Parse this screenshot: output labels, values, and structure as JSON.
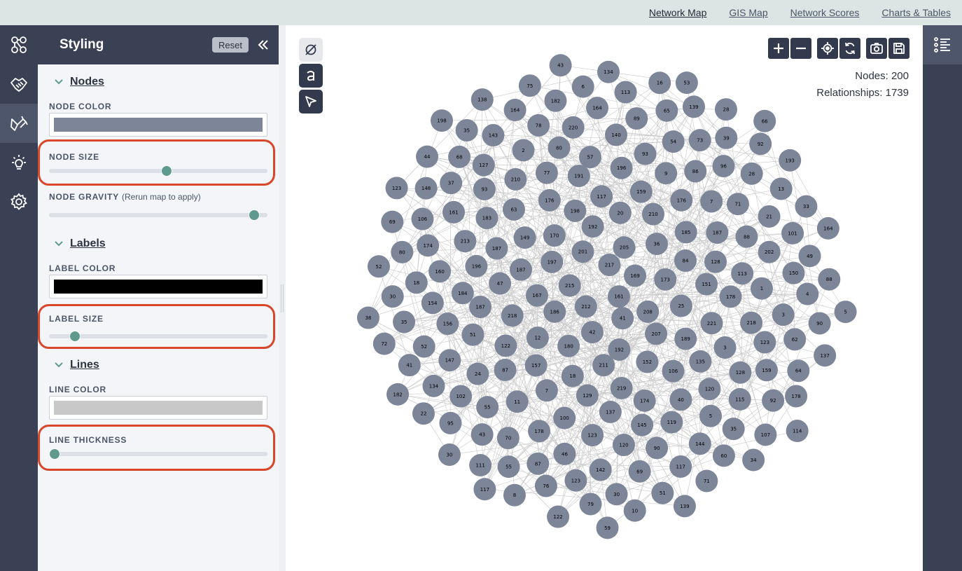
{
  "topnav": {
    "items": [
      {
        "label": "Network Map",
        "active": true
      },
      {
        "label": "GIS Map",
        "active": false
      },
      {
        "label": "Network Scores",
        "active": false
      },
      {
        "label": "Charts & Tables",
        "active": false
      }
    ]
  },
  "rail": {
    "items": [
      {
        "icon": "network-icon"
      },
      {
        "icon": "handshake-icon"
      },
      {
        "icon": "paintbrush-icon",
        "active": true
      },
      {
        "icon": "lightbulb-icon"
      },
      {
        "icon": "gear-icon"
      }
    ]
  },
  "panel": {
    "title": "Styling",
    "reset_label": "Reset",
    "collapse_icon": "double-chevron-left-icon",
    "sections": {
      "nodes": {
        "title": "Nodes",
        "color_label": "NODE COLOR",
        "color_value": "#7d8599",
        "size_label": "NODE SIZE",
        "size_value": 0.54,
        "gravity_label": "NODE GRAVITY",
        "gravity_hint": "(Rerun map to apply)",
        "gravity_value": 0.94
      },
      "labels": {
        "title": "Labels",
        "color_label": "LABEL COLOR",
        "color_value": "#000000",
        "size_label": "LABEL SIZE",
        "size_value": 0.12
      },
      "lines": {
        "title": "Lines",
        "color_label": "LINE COLOR",
        "color_value": "#c8c8c8",
        "thickness_label": "LINE THICKNESS",
        "thickness_value": 0.025
      }
    }
  },
  "canvas": {
    "tools": [
      "clear-icon",
      "label-toggle-icon",
      "pointer-icon"
    ],
    "controls": [
      "zoom-in-icon",
      "zoom-out-icon",
      "locate-icon",
      "refresh-icon",
      "camera-icon",
      "save-icon"
    ],
    "nodes_label": "Nodes: 200",
    "relationships_label": "Relationships: 1739",
    "node_fill": "#7d8599",
    "edge_color": "#c8c8c8"
  },
  "network": {
    "node_labels": [
      "161",
      "212",
      "217",
      "41",
      "215",
      "169",
      "42",
      "201",
      "208",
      "186",
      "205",
      "192",
      "197",
      "173",
      "180",
      "192",
      "207",
      "167",
      "36",
      "211",
      "170",
      "25",
      "12",
      "20",
      "152",
      "187",
      "84",
      "18",
      "198",
      "189",
      "218",
      "210",
      "219",
      "149",
      "151",
      "157",
      "117",
      "106",
      "47",
      "185",
      "129",
      "176",
      "221",
      "122",
      "159",
      "174",
      "187",
      "128",
      "7",
      "191",
      "135",
      "187",
      "176",
      "137",
      "63",
      "178",
      "87",
      "196",
      "40",
      "196",
      "187",
      "100",
      "77",
      "3",
      "51",
      "9",
      "145",
      "183",
      "113",
      "11",
      "57",
      "120",
      "184",
      "7",
      "123",
      "210",
      "218",
      "24",
      "93",
      "119",
      "213",
      "88",
      "178",
      "80",
      "128",
      "156",
      "86",
      "120",
      "93",
      "1",
      "55",
      "140",
      "5",
      "160",
      "71",
      "46",
      "2",
      "123",
      "147",
      "54",
      "90",
      "161",
      "202",
      "70",
      "220",
      "115",
      "154",
      "96",
      "142",
      "127",
      "3",
      "102",
      "89",
      "144",
      "174",
      "21",
      "87",
      "78",
      "159",
      "52",
      "73",
      "69",
      "37",
      "150",
      "43",
      "164",
      "35",
      "18",
      "28",
      "123",
      "143",
      "62",
      "134",
      "65",
      "117",
      "106",
      "101",
      "55",
      "182",
      "92",
      "35",
      "39",
      "30",
      "68",
      "4",
      "95",
      "113",
      "60",
      "80",
      "13",
      "76",
      "164",
      "64",
      "41",
      "139",
      "51",
      "148",
      "49",
      "111",
      "6",
      "107",
      "30",
      "92",
      "79",
      "35",
      "90",
      "22",
      "16",
      "71",
      "69",
      "33",
      "8",
      "75",
      "178",
      "72",
      "28",
      "10",
      "44",
      "88",
      "30",
      "134",
      "34",
      "52",
      "193",
      "122",
      "138",
      "137",
      "182",
      "53",
      "139",
      "123",
      "164",
      "117",
      "43",
      "114",
      "38",
      "66",
      "59",
      "198",
      "5"
    ]
  }
}
